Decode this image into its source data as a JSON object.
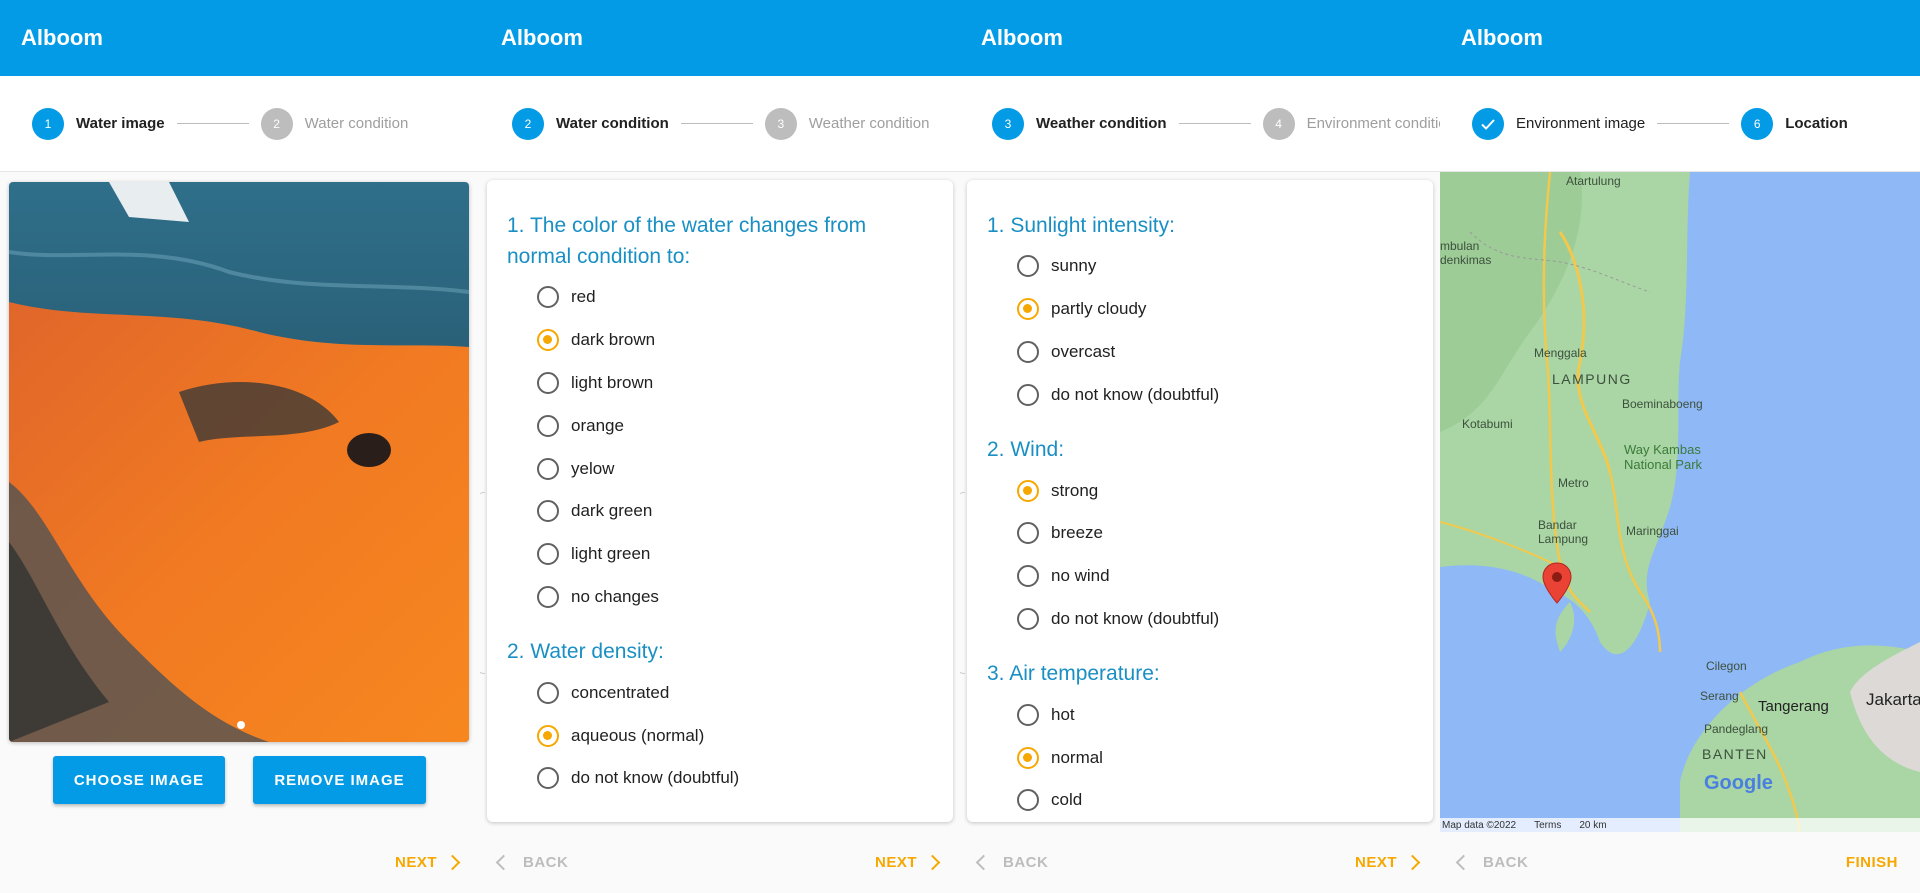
{
  "app_title": "Alboom",
  "colors": {
    "primary": "#039be5",
    "accent": "#f6a800",
    "question": "#1a8fc4"
  },
  "screen1": {
    "steps": [
      {
        "num": "1",
        "label": "Water image",
        "state": "active"
      },
      {
        "num": "2",
        "label": "Water condition",
        "state": "inactive"
      }
    ],
    "choose_image": "CHOOSE IMAGE",
    "remove_image": "REMOVE IMAGE",
    "next": "NEXT"
  },
  "screen2": {
    "steps": [
      {
        "num": "2",
        "label": "Water condition",
        "state": "active"
      },
      {
        "num": "3",
        "label": "Weather condition",
        "state": "inactive"
      }
    ],
    "questions": [
      {
        "title": "1. The color of the water changes from normal condition to:",
        "options": [
          {
            "label": "red",
            "selected": false
          },
          {
            "label": "dark brown",
            "selected": true
          },
          {
            "label": "light brown",
            "selected": false
          },
          {
            "label": "orange",
            "selected": false
          },
          {
            "label": "yelow",
            "selected": false
          },
          {
            "label": "dark green",
            "selected": false
          },
          {
            "label": "light green",
            "selected": false
          },
          {
            "label": "no changes",
            "selected": false
          }
        ]
      },
      {
        "title": "2. Water density:",
        "options": [
          {
            "label": "concentrated",
            "selected": false
          },
          {
            "label": "aqueous (normal)",
            "selected": true
          },
          {
            "label": "do not know (doubtful)",
            "selected": false
          }
        ]
      }
    ],
    "back": "BACK",
    "next": "NEXT"
  },
  "screen3": {
    "steps": [
      {
        "num": "3",
        "label": "Weather condition",
        "state": "active"
      },
      {
        "num": "4",
        "label": "Environment condition",
        "state": "inactive"
      }
    ],
    "questions": [
      {
        "title": "1. Sunlight intensity:",
        "options": [
          {
            "label": "sunny",
            "selected": false
          },
          {
            "label": "partly cloudy",
            "selected": true
          },
          {
            "label": "overcast",
            "selected": false
          },
          {
            "label": "do not know (doubtful)",
            "selected": false
          }
        ]
      },
      {
        "title": "2. Wind:",
        "options": [
          {
            "label": "strong",
            "selected": true
          },
          {
            "label": "breeze",
            "selected": false
          },
          {
            "label": "no wind",
            "selected": false
          },
          {
            "label": "do not know (doubtful)",
            "selected": false
          }
        ]
      },
      {
        "title": "3. Air temperature:",
        "options": [
          {
            "label": "hot",
            "selected": false
          },
          {
            "label": "normal",
            "selected": true
          },
          {
            "label": "cold",
            "selected": false
          }
        ]
      }
    ],
    "back": "BACK",
    "next": "NEXT"
  },
  "screen4": {
    "steps": [
      {
        "num": "✓",
        "label": "Environment image",
        "state": "done"
      },
      {
        "num": "6",
        "label": "Location",
        "state": "active"
      }
    ],
    "map_labels": {
      "atartulung": "Atartulung",
      "tambulan": "mbulan",
      "kedenkimas": "denkimas",
      "menggala": "Menggala",
      "lampung": "LAMPUNG",
      "boeminaboeng": "Boeminaboeng",
      "kotabumi": "Kotabumi",
      "way_kambas_1": "Way Kambas",
      "way_kambas_2": "National Park",
      "metro": "Metro",
      "bandar_1": "Bandar",
      "bandar_2": "Lampung",
      "maringgai": "Maringgai",
      "cilegon": "Cilegon",
      "serang": "Serang",
      "tangerang": "Tangerang",
      "jakarta": "Jakarta",
      "pandeglang": "Pandeglang",
      "banten": "BANTEN",
      "google": "Google"
    },
    "map_footer": {
      "data": "Map data ©2022",
      "terms": "Terms",
      "scale": "20 km"
    },
    "back": "BACK",
    "finish": "FINISH"
  }
}
